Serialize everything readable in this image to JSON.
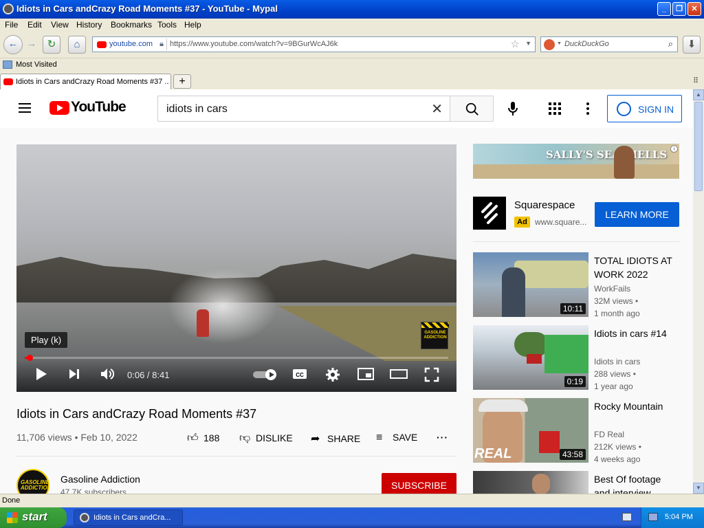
{
  "window": {
    "title": "Idiots in Cars andCrazy Road Moments #37 - YouTube - Mypal",
    "minimize": "_",
    "maximize": "❐",
    "close": "✕"
  },
  "menu": [
    "File",
    "Edit",
    "View",
    "History",
    "Bookmarks",
    "Tools",
    "Help"
  ],
  "nav": {
    "site_label": "youtube.com",
    "url": "https://www.youtube.com/watch?v=9BGurWcAJ6k",
    "search_placeholder": "DuckDuckGo"
  },
  "bookmarks": {
    "most_visited": "Most Visited"
  },
  "tabs": [
    {
      "label": "Idiots in Cars andCrazy Road Moments #37 ..."
    }
  ],
  "youtube": {
    "logo_text": "YouTube",
    "search_query": "idiots in cars",
    "sign_in": "SIGN IN"
  },
  "player": {
    "tooltip": "Play (k)",
    "current_time": "0:06",
    "duration": "8:41",
    "time_display": "0:06 / 8:41",
    "progress": 0.012,
    "badge_text": "GASOLINE ADDICTION"
  },
  "video": {
    "title": "Idiots in Cars andCrazy Road Moments #37",
    "meta": "11,706 views • Feb 10, 2022",
    "likes": "188",
    "dislike": "DISLIKE",
    "share": "SHARE",
    "save": "SAVE"
  },
  "channel": {
    "name": "Gasoline Addiction",
    "subscribers": "47.7K subscribers",
    "avatar_text": "GASOLINE ADDICTION",
    "subscribe": "SUBSCRIBE"
  },
  "ad": {
    "banner_text": "SALLY'S SEASHELLS",
    "name": "Squarespace",
    "tag": "Ad",
    "url": "www.square...",
    "cta": "LEARN MORE",
    "info": "i"
  },
  "recommendations": [
    {
      "title": "TOTAL IDIOTS AT WORK 2022",
      "channel": "WorkFails",
      "views": "32M views •",
      "age": "1 month ago",
      "duration": "10:11"
    },
    {
      "title": "Idiots in cars #14",
      "channel": "Idiots in cars",
      "views": "288 views •",
      "age": "1 year ago",
      "duration": "0:19"
    },
    {
      "title": "Rocky Mountain",
      "channel": "FD Real",
      "views": "212K views •",
      "age": "4 weeks ago",
      "duration": "43:58"
    },
    {
      "title": "Best Of footage and interview",
      "channel": "",
      "views": "",
      "age": "",
      "duration": ""
    }
  ],
  "thumb_text": {
    "real": "REAL"
  },
  "status": {
    "text": "Done"
  },
  "taskbar": {
    "start": "start",
    "item": "Idiots in Cars andCra...",
    "clock": "5:04 PM"
  },
  "colors": {
    "youtube_red": "#ff0000",
    "subscribe_red": "#cc0000",
    "link_blue": "#065fd4",
    "xp_blue": "#0a5ce6"
  }
}
